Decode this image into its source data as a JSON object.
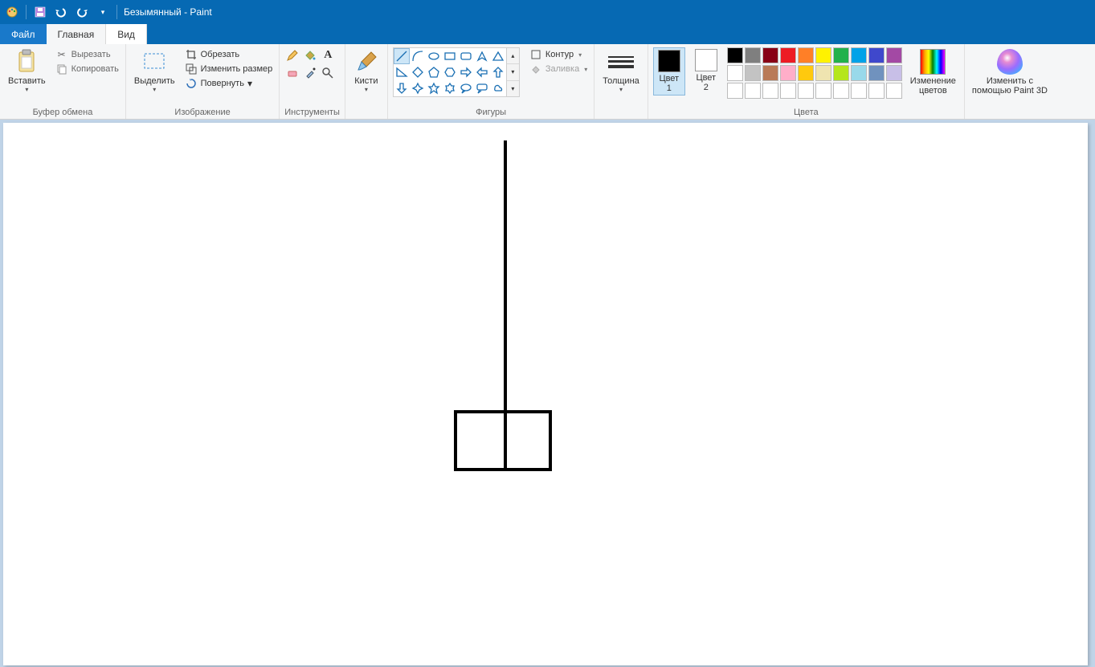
{
  "title": "Безымянный - Paint",
  "tabs": {
    "file": "Файл",
    "home": "Главная",
    "view": "Вид"
  },
  "clipboard": {
    "paste": "Вставить",
    "cut": "Вырезать",
    "copy": "Копировать",
    "group": "Буфер обмена"
  },
  "image": {
    "select": "Выделить",
    "crop": "Обрезать",
    "resize": "Изменить размер",
    "rotate": "Повернуть",
    "group": "Изображение"
  },
  "tools": {
    "group": "Инструменты"
  },
  "brushes": {
    "label": "Кисти",
    "group": ""
  },
  "shapes": {
    "outline": "Контур",
    "fill": "Заливка",
    "group": "Фигуры"
  },
  "thickness": {
    "label": "Толщина"
  },
  "colors": {
    "color1": "Цвет\n1",
    "color2": "Цвет\n2",
    "edit": "Изменение\nцветов",
    "group": "Цвета",
    "row1": [
      "#000000",
      "#7f7f7f",
      "#880015",
      "#ed1c24",
      "#ff7f27",
      "#fff200",
      "#22b14c",
      "#00a2e8",
      "#3f48cc",
      "#a349a4"
    ],
    "row2": [
      "#ffffff",
      "#c3c3c3",
      "#b97a57",
      "#ffaec9",
      "#ffc90e",
      "#efe4b0",
      "#b5e61d",
      "#99d9ea",
      "#7092be",
      "#c8bfe7"
    ],
    "row3": [
      "#ffffff",
      "#ffffff",
      "#ffffff",
      "#ffffff",
      "#ffffff",
      "#ffffff",
      "#ffffff",
      "#ffffff",
      "#ffffff",
      "#ffffff"
    ]
  },
  "paint3d": {
    "label": "Изменить с\nпомощью Paint 3D"
  }
}
